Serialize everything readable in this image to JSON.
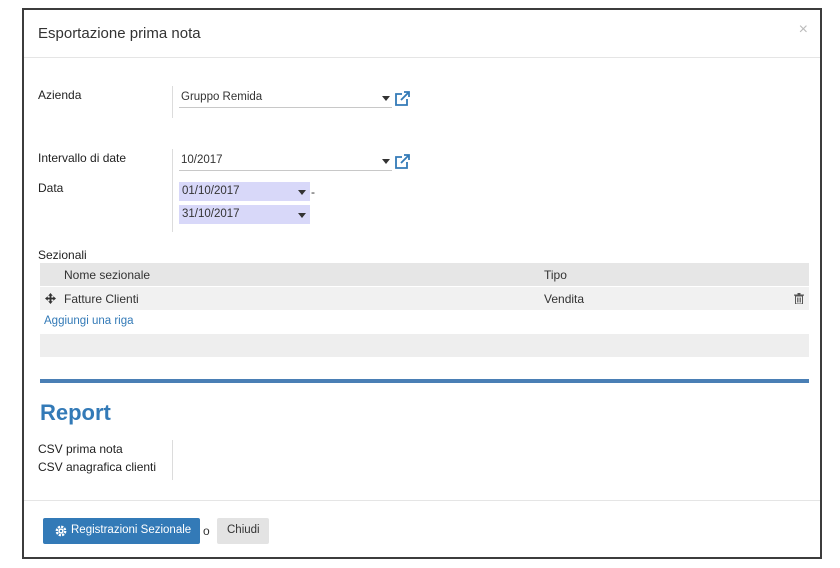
{
  "dialog": {
    "title": "Esportazione prima nota",
    "close_glyph": "×"
  },
  "form": {
    "company_label": "Azienda",
    "company_value": "Gruppo Remida",
    "date_range_label": "Intervallo di date",
    "date_range_value": "10/2017",
    "date_label": "Data",
    "date_from": "01/10/2017",
    "date_to": "31/10/2017",
    "date_separator": "-"
  },
  "sections": {
    "label": "Sezionali",
    "columns": [
      "Nome sezionale",
      "Tipo"
    ],
    "rows": [
      {
        "name": "Fatture Clienti",
        "type": "Vendita"
      }
    ],
    "add_line": "Aggiungi una riga"
  },
  "report": {
    "title": "Report",
    "items": [
      "CSV prima nota",
      "CSV anagrafica clienti"
    ]
  },
  "footer": {
    "primary_label": "Registrazioni Sezionale",
    "or_text": "o",
    "close_label": "Chiudi"
  },
  "icons": {
    "close": "close-icon",
    "external_link": "external-link-icon",
    "drag_handle": "move-icon",
    "delete": "trash-icon",
    "gear": "gear-icon"
  },
  "colors": {
    "accent": "#337ab7",
    "date_field_bg": "#d8d8f9",
    "separator": "#4a7fb5"
  }
}
